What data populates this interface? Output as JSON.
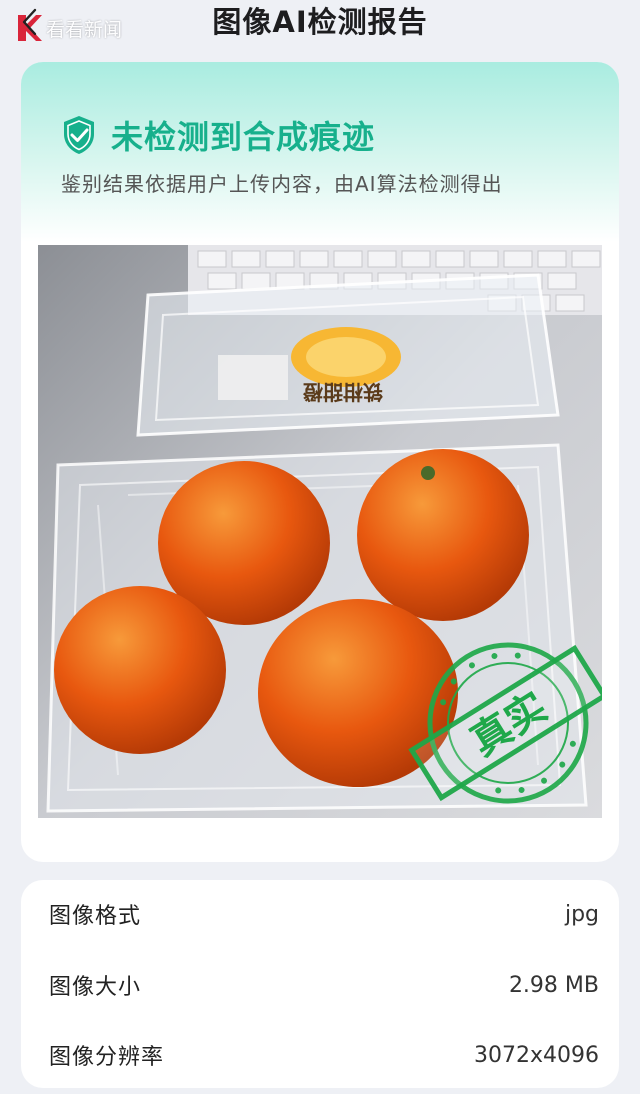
{
  "header": {
    "title": "图像AI检测报告",
    "logo_text": "看看新闻"
  },
  "result": {
    "verdict": "未检测到合成痕迹",
    "description": "鉴别结果依据用户上传内容，由AI算法检测得出",
    "stamp_text": "真实"
  },
  "photo": {
    "box_label": "铁柑甜橙",
    "orange_count": 4
  },
  "info": {
    "rows": [
      {
        "label": "图像格式",
        "value": "jpg"
      },
      {
        "label": "图像大小",
        "value": "2.98 MB"
      },
      {
        "label": "图像分辨率",
        "value": "3072x4096"
      }
    ]
  },
  "colors": {
    "accent": "#17b08c",
    "stamp": "#1fa84a",
    "orange": "#e8580f",
    "logo_red": "#d9253a"
  },
  "icons": {
    "back": "chevron-left-icon",
    "verdict": "shield-check-icon"
  }
}
